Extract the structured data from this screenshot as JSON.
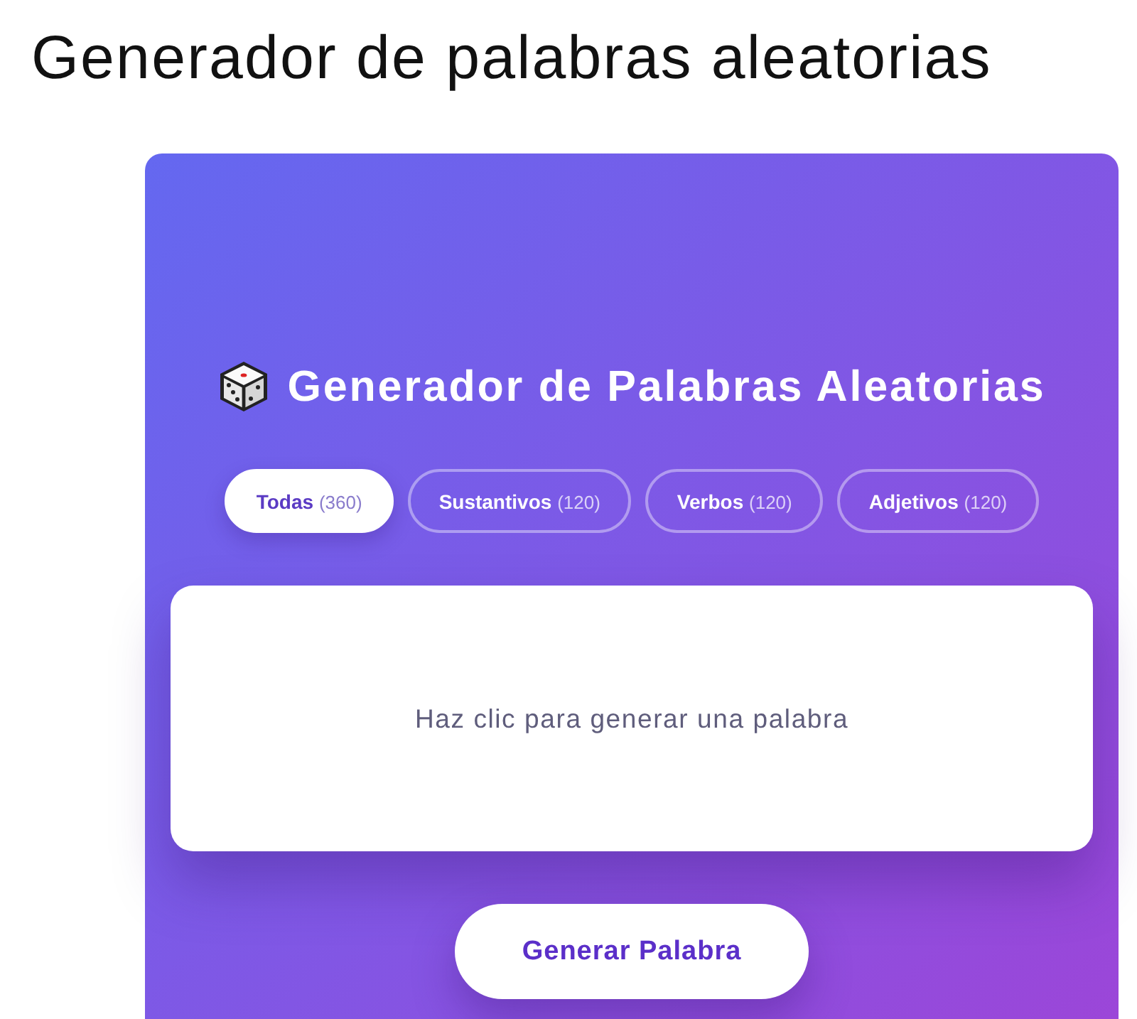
{
  "page": {
    "heading": "Generador de palabras aleatorias"
  },
  "card": {
    "title": "Generador de Palabras Aleatorias",
    "tabs": [
      {
        "label": "Todas",
        "count": "(360)",
        "selected": true
      },
      {
        "label": "Sustantivos",
        "count": "(120)",
        "selected": false
      },
      {
        "label": "Verbos",
        "count": "(120)",
        "selected": false
      },
      {
        "label": "Adjetivos",
        "count": "(120)",
        "selected": false
      }
    ],
    "output": {
      "text": "Haz clic para generar una palabra"
    },
    "button": {
      "label": "Generar Palabra"
    }
  }
}
